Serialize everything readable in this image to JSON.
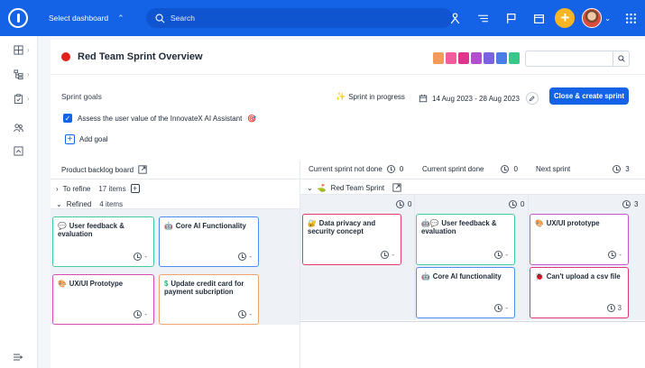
{
  "topbar": {
    "dashboard_select": "Select dashboard",
    "search_placeholder": "Search"
  },
  "page": {
    "title": "Red Team Sprint Overview",
    "swatch_colors": [
      "#f49a5b",
      "#f25c9a",
      "#e0358d",
      "#b34fcf",
      "#7a62e0",
      "#4a7de6",
      "#38c98a"
    ]
  },
  "sprint": {
    "goals_label": "Sprint goals",
    "status": "Sprint in progress",
    "dates": "14 Aug 2023 - 28 Aug 2023",
    "close_button": "Close & create sprint",
    "goal_1": "Assess the user value of the InnovateX AI Assistant",
    "add_goal": "Add goal"
  },
  "board": {
    "backlog_header": "Product backlog board",
    "col_not_done": "Current sprint not done",
    "col_not_done_count": "0",
    "col_done": "Current sprint done",
    "col_done_count": "0",
    "col_next": "Next sprint",
    "col_next_count": "3",
    "group_to_refine": "To refine",
    "group_to_refine_count": "17 items",
    "group_refined": "Refined",
    "group_refined_count": "4 items",
    "sprint_name": "Red Team Sprint",
    "sprint_not_done_count": "0",
    "sprint_done_count": "0",
    "sprint_next_count": "3"
  },
  "cards": {
    "backlog_1": {
      "title": "User feedback & evaluation",
      "estimate": "-"
    },
    "backlog_2": {
      "title": "Core AI Functionality",
      "estimate": "-"
    },
    "backlog_3": {
      "title": "UX/UI Prototype",
      "estimate": "-"
    },
    "backlog_4": {
      "title": "Update credit card for payment subcription",
      "estimate": "-"
    },
    "notdone_1": {
      "title": "Data privacy and security concept",
      "estimate": "-"
    },
    "done_1": {
      "title": "User feedback & evaluation",
      "estimate": "-"
    },
    "done_2": {
      "title": "Core AI functionality",
      "estimate": "-"
    },
    "next_1": {
      "title": "UX/UI prototype",
      "estimate": "-"
    },
    "next_2": {
      "title": "Can't upload a csv file",
      "estimate": "3"
    }
  }
}
